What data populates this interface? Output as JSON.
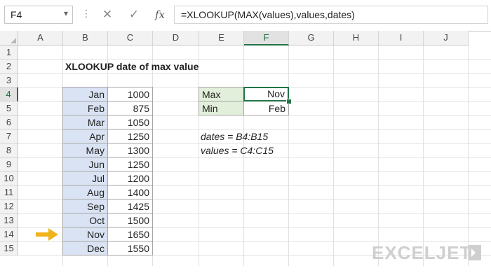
{
  "formula_bar": {
    "name_box": "F4",
    "name_box_arrow": "▾",
    "menu_dots": "⋮",
    "cancel_glyph": "✕",
    "enter_glyph": "✓",
    "fx_glyph": "fx",
    "formula": "=XLOOKUP(MAX(values),values,dates)"
  },
  "grid": {
    "columns": [
      "A",
      "B",
      "C",
      "D",
      "E",
      "F",
      "G",
      "H",
      "I",
      "J"
    ],
    "selected_column": "F",
    "rows": [
      "1",
      "2",
      "3",
      "4",
      "5",
      "6",
      "7",
      "8",
      "9",
      "10",
      "11",
      "12",
      "13",
      "14",
      "15"
    ],
    "selected_row": "4"
  },
  "sheet": {
    "title": "XLOOKUP date of max value",
    "dates": [
      "Jan",
      "Feb",
      "Mar",
      "Apr",
      "May",
      "Jun",
      "Jul",
      "Aug",
      "Sep",
      "Oct",
      "Nov",
      "Dec"
    ],
    "values": [
      "1000",
      "875",
      "1050",
      "1250",
      "1300",
      "1250",
      "1200",
      "1400",
      "1425",
      "1500",
      "1650",
      "1550"
    ],
    "summary": {
      "max_label": "Max",
      "max_result": "Nov",
      "min_label": "Min",
      "min_result": "Feb"
    },
    "named_ranges": {
      "dates_def": "dates = B4:B15",
      "values_def": "values = C4:C15"
    },
    "pointer_row": "14"
  },
  "branding": {
    "logo_text": "EXCELJET",
    "logo_color": "#cfcfcf"
  },
  "colors": {
    "accent": "#217346",
    "date_fill": "#dae3f3",
    "label_fill": "#e2efda",
    "arrow": "#f0b31b"
  }
}
